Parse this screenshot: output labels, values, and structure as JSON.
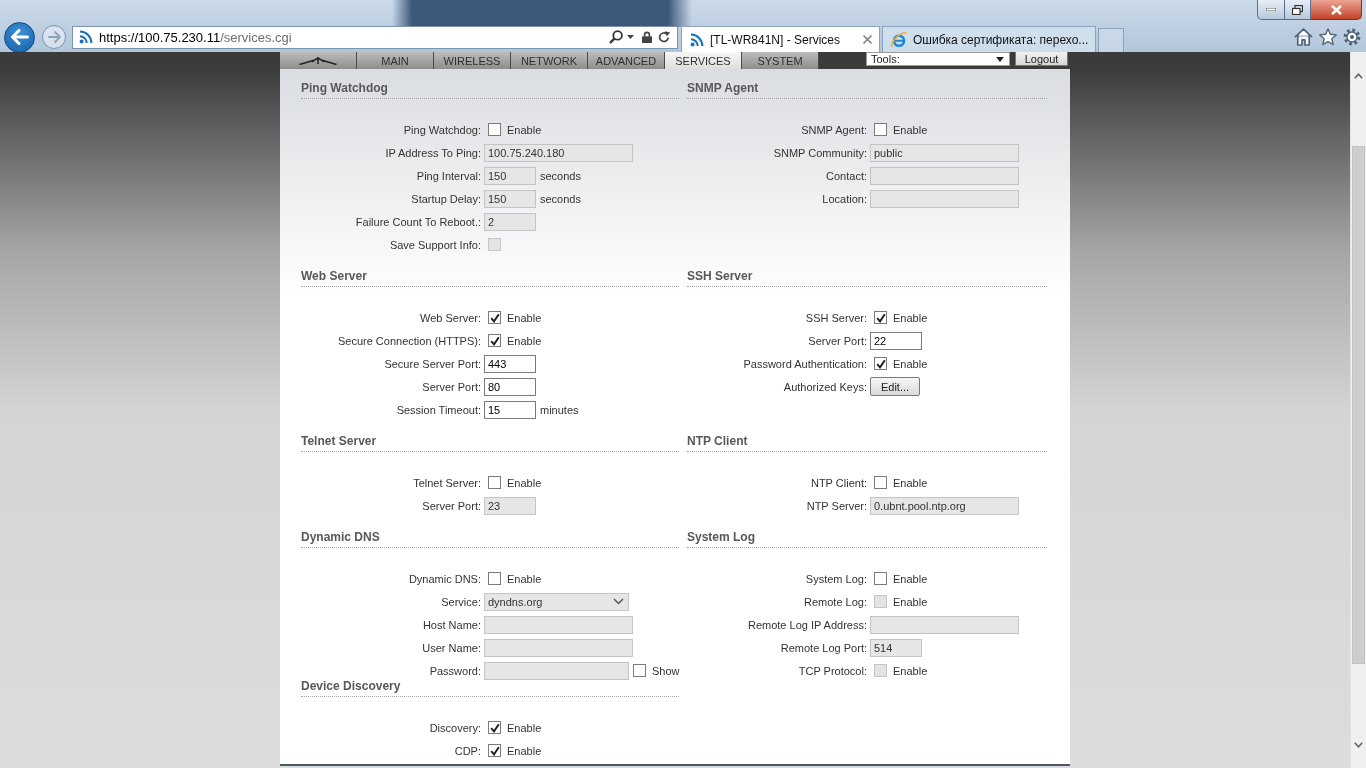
{
  "browser": {
    "address": {
      "origin": "https://100.75.230.11",
      "path": "/services.cgi"
    },
    "tabs": [
      {
        "kind": "site",
        "title": "[TL-WR841N] - Services",
        "selected": true
      },
      {
        "kind": "error",
        "title": "Ошибка сертификата: перехо...",
        "selected": false
      }
    ]
  },
  "page": {
    "nav_tabs": [
      {
        "kind": "logo",
        "selected": false
      },
      {
        "kind": "text",
        "label": "MAIN",
        "selected": false
      },
      {
        "kind": "text",
        "label": "WIRELESS",
        "selected": false
      },
      {
        "kind": "text",
        "label": "NETWORK",
        "selected": false
      },
      {
        "kind": "text",
        "label": "ADVANCED",
        "selected": false
      },
      {
        "kind": "text",
        "label": "SERVICES",
        "selected": true
      },
      {
        "kind": "text",
        "label": "SYSTEM",
        "selected": false
      }
    ],
    "tools": {
      "value": "Tools:"
    },
    "logout": "Logout",
    "section_rows": [
      {
        "left": [
          {
            "title": "Ping Watchdog",
            "fields": [
              {
                "kind": "checkbox",
                "label": "Ping Watchdog:",
                "checked": false,
                "disabled": false,
                "text": "Enable"
              },
              {
                "kind": "input_wide",
                "label": "IP Address To Ping:",
                "value": "100.75.240.180",
                "disabled": true
              },
              {
                "kind": "input_short",
                "label": "Ping Interval:",
                "value": "150",
                "disabled": true,
                "unit": "seconds"
              },
              {
                "kind": "input_short",
                "label": "Startup Delay:",
                "value": "150",
                "disabled": true,
                "unit": "seconds"
              },
              {
                "kind": "input_short",
                "label": "Failure Count To Reboot.:",
                "value": "2",
                "disabled": true
              },
              {
                "kind": "checkbox",
                "label": "Save Support Info:",
                "checked": false,
                "disabled": true
              }
            ]
          }
        ],
        "right": [
          {
            "title": "SNMP Agent",
            "fields": [
              {
                "kind": "checkbox",
                "label": "SNMP Agent:",
                "checked": false,
                "disabled": false,
                "text": "Enable"
              },
              {
                "kind": "input_wide",
                "label": "SNMP Community:",
                "value": "public",
                "disabled": true
              },
              {
                "kind": "input_wide",
                "label": "Contact:",
                "disabled": true
              },
              {
                "kind": "input_wide",
                "label": "Location:",
                "disabled": true
              }
            ]
          }
        ]
      },
      {
        "left": [
          {
            "title": "Web Server",
            "fields": [
              {
                "kind": "checkbox",
                "label": "Web Server:",
                "checked": true,
                "disabled": false,
                "text": "Enable"
              },
              {
                "kind": "checkbox",
                "label": "Secure Connection (HTTPS):",
                "checked": true,
                "disabled": false,
                "text": "Enable"
              },
              {
                "kind": "input_short",
                "label": "Secure Server Port:",
                "value": "443",
                "disabled": false
              },
              {
                "kind": "input_short",
                "label": "Server Port:",
                "value": "80",
                "disabled": false
              },
              {
                "kind": "input_short",
                "label": "Session Timeout:",
                "value": "15",
                "disabled": false,
                "unit": "minutes"
              }
            ]
          }
        ],
        "right": [
          {
            "title": "SSH Server",
            "fields": [
              {
                "kind": "checkbox",
                "label": "SSH Server:",
                "checked": true,
                "disabled": false,
                "text": "Enable"
              },
              {
                "kind": "input_short",
                "label": "Server Port:",
                "value": "22",
                "disabled": false
              },
              {
                "kind": "checkbox",
                "label": "Password Authentication:",
                "checked": true,
                "disabled": false,
                "text": "Enable"
              },
              {
                "kind": "button",
                "label": "Authorized Keys:",
                "text": "Edit..."
              }
            ]
          }
        ]
      },
      {
        "left": [
          {
            "title": "Telnet Server",
            "fields": [
              {
                "kind": "checkbox",
                "label": "Telnet Server:",
                "checked": false,
                "disabled": false,
                "text": "Enable"
              },
              {
                "kind": "input_short",
                "label": "Server Port:",
                "value": "23",
                "disabled": true
              }
            ]
          }
        ],
        "right": [
          {
            "title": "NTP Client",
            "fields": [
              {
                "kind": "checkbox",
                "label": "NTP Client:",
                "checked": false,
                "disabled": false,
                "text": "Enable"
              },
              {
                "kind": "input_wide",
                "label": "NTP Server:",
                "value": "0.ubnt.pool.ntp.org",
                "disabled": true
              }
            ]
          }
        ]
      },
      {
        "left": [
          {
            "title": "Dynamic DNS",
            "fields": [
              {
                "kind": "checkbox",
                "label": "Dynamic DNS:",
                "checked": false,
                "disabled": false,
                "text": "Enable"
              },
              {
                "kind": "select",
                "label": "Service:",
                "value": "dyndns.org",
                "disabled": true
              },
              {
                "kind": "input_wide",
                "label": "Host Name:",
                "disabled": true
              },
              {
                "kind": "input_wide",
                "label": "User Name:",
                "disabled": true
              },
              {
                "kind": "password",
                "label": "Password:",
                "disabled": true,
                "show": {
                  "text": "Show",
                  "checked": false
                }
              }
            ]
          },
          {
            "title": "Device Discovery",
            "fields": [
              {
                "kind": "checkbox",
                "label": "Discovery:",
                "checked": true,
                "disabled": false,
                "text": "Enable"
              },
              {
                "kind": "checkbox",
                "label": "CDP:",
                "checked": true,
                "disabled": false,
                "text": "Enable"
              }
            ]
          }
        ],
        "right": [
          {
            "title": "System Log",
            "fields": [
              {
                "kind": "checkbox",
                "label": "System Log:",
                "checked": false,
                "disabled": false,
                "text": "Enable"
              },
              {
                "kind": "checkbox",
                "label": "Remote Log:",
                "checked": false,
                "disabled": true,
                "text": "Enable"
              },
              {
                "kind": "input_wide",
                "label": "Remote Log IP Address:",
                "disabled": true
              },
              {
                "kind": "input_short",
                "label": "Remote Log Port:",
                "value": "514",
                "disabled": true
              },
              {
                "kind": "checkbox",
                "label": "TCP Protocol:",
                "checked": false,
                "disabled": true,
                "text": "Enable"
              }
            ]
          }
        ]
      }
    ]
  }
}
